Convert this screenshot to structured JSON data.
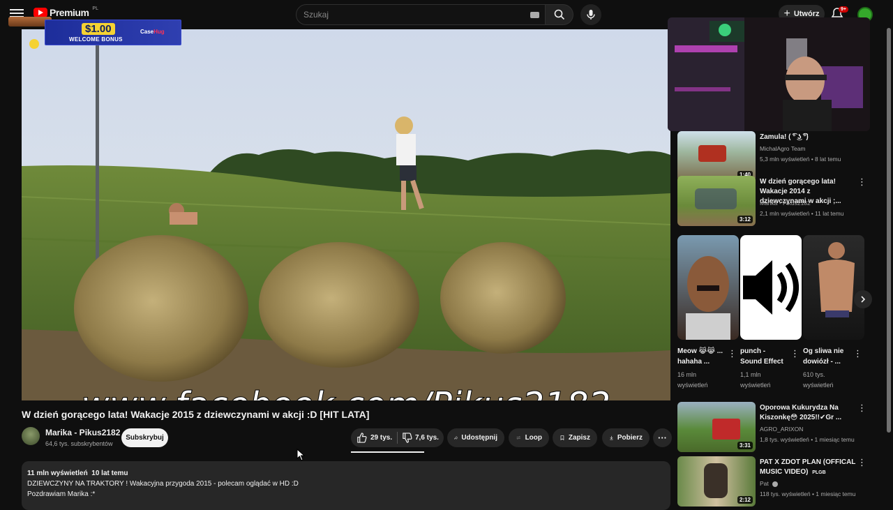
{
  "header": {
    "logo_text": "Premium",
    "country": "PL",
    "search_placeholder": "Szukaj",
    "create_label": "Utwórz",
    "notifications": "9+"
  },
  "overlay": {
    "bonus_amount": "$1.00",
    "bonus_text": "WELCOME BONUS",
    "bonus_brand_a": "Case",
    "bonus_brand_b": "Hug"
  },
  "video": {
    "watermark": "www.facebook.com/Pikus2182",
    "title": "W dzień gorącego lata! Wakacje 2015 z dziewczynami w akcji :D [HIT LATA]",
    "channel": "Marika - Pikus2182",
    "subscribers": "64,6 tys. subskrybentów",
    "subscribe_label": "Subskrybuj",
    "likes": "29 tys.",
    "dislikes": "7,6 tys.",
    "like_ratio": 0.79,
    "actions": {
      "share": "Udostępnij",
      "loop": "Loop",
      "save": "Zapisz",
      "download": "Pobierz",
      "more": "···"
    },
    "description": {
      "views": "11 mln wyświetleń",
      "age": "10 lat temu",
      "line1": "DZIEWCZYNY NA TRAKTORY ! Wakacyjna przygoda 2015 - polecam oglądać w HD :D",
      "line2": "Pozdrawiam Marika :*"
    }
  },
  "recommendations": [
    {
      "title": "Zamula! ( ͡° ͜ʖ ͡°)",
      "channel": "MichalAgro Team",
      "meta": "5,3 mln wyświetleń • 8 lat temu",
      "duration": "1:40"
    },
    {
      "title": "W dzień gorącego lata! Wakacje 2014 z dziewczynami w akcji ;...",
      "channel": "Marika - Pikus2182",
      "meta": "2,1 mln wyświetleń • 11 lat temu",
      "duration": "3:12"
    },
    {
      "title": "Oporowa Kukurydza Na Kiszonkę😳 2025!!✔Gr ...",
      "channel": "AGRO_ARIXON",
      "meta": "1,8 tys. wyświetleń • 1 miesiąc temu",
      "duration": "3:31"
    },
    {
      "title": "PAT X ZDOT PLAN (OFFICAL MUSIC VIDEO)",
      "title_badge": "PLGB",
      "channel": "Pat",
      "meta": "118 tys. wyświetleń • 1 miesiąc temu",
      "duration": "2:12"
    }
  ],
  "shorts": [
    {
      "title": "Meow 😹😹 ... hahaha ...",
      "views": "16 mln wyświetleń"
    },
    {
      "title": "punch - Sound Effect",
      "views": "1,1 mln wyświetleń"
    },
    {
      "title": "Og sliwa nie dowiózł - ...",
      "views": "610 tys. wyświetleń"
    }
  ],
  "colors": {
    "background": "#0f0f0f",
    "surface": "#272727",
    "brand_red": "#ff0000",
    "text": "#f1f1f1",
    "muted": "#aaaaaa"
  }
}
